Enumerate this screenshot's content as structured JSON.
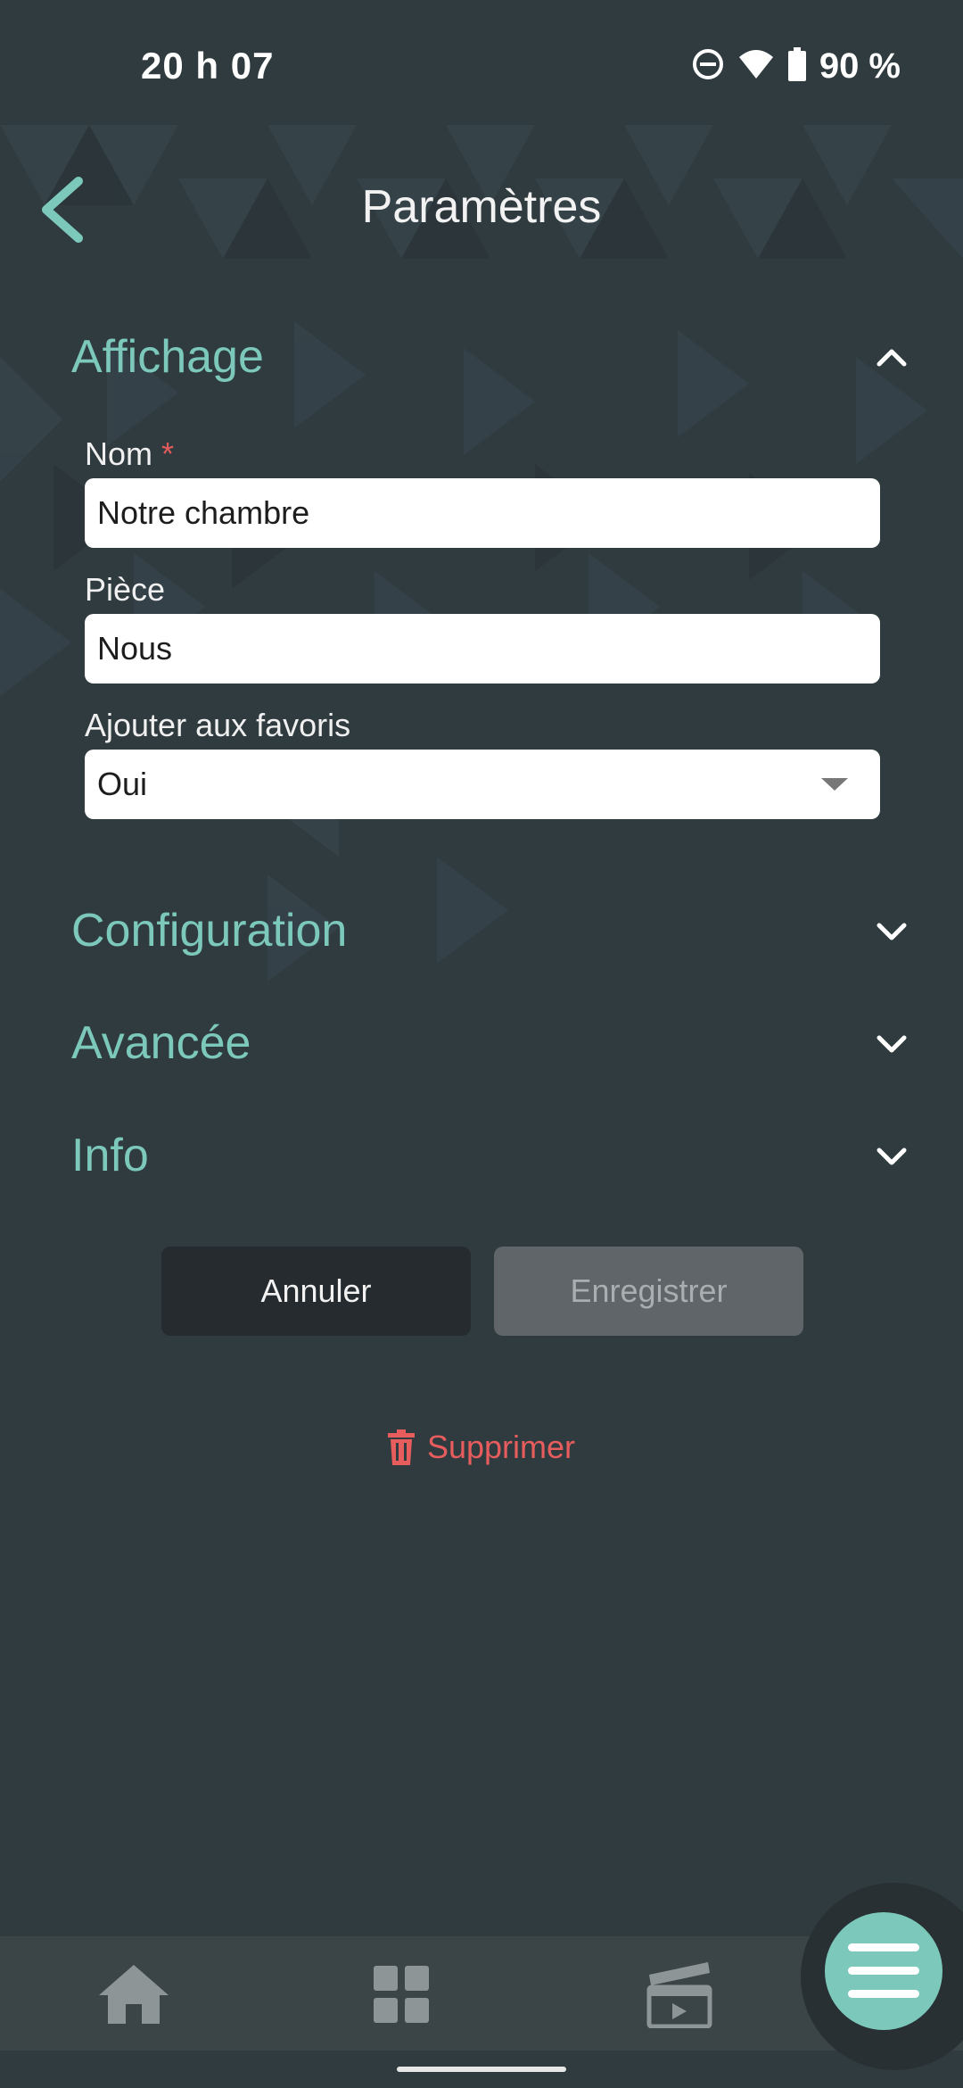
{
  "status_bar": {
    "time": "20 h 07",
    "battery": "90 %",
    "icons": [
      "do-not-disturb-icon",
      "wifi-icon",
      "battery-icon"
    ]
  },
  "header": {
    "title": "Paramètres",
    "back_icon": "chevron-left-icon"
  },
  "sections": {
    "affichage": {
      "title": "Affichage",
      "expanded": true
    },
    "configuration": {
      "title": "Configuration",
      "expanded": false
    },
    "avancee": {
      "title": "Avancée",
      "expanded": false
    },
    "info": {
      "title": "Info",
      "expanded": false
    }
  },
  "form": {
    "nom": {
      "label": "Nom",
      "required_mark": "*",
      "value": "Notre chambre"
    },
    "piece": {
      "label": "Pièce",
      "value": "Nous"
    },
    "favoris": {
      "label": "Ajouter aux favoris",
      "value": "Oui"
    }
  },
  "actions": {
    "cancel_label": "Annuler",
    "save_label": "Enregistrer",
    "delete_label": "Supprimer"
  },
  "bottom_nav": {
    "items": [
      "home-icon",
      "grid-icon",
      "scenes-clapperboard-icon"
    ],
    "fab_icon": "menu-icon"
  },
  "colors": {
    "accent": "#7cc9bc",
    "background": "#303b3f",
    "danger": "#e75d5d"
  }
}
